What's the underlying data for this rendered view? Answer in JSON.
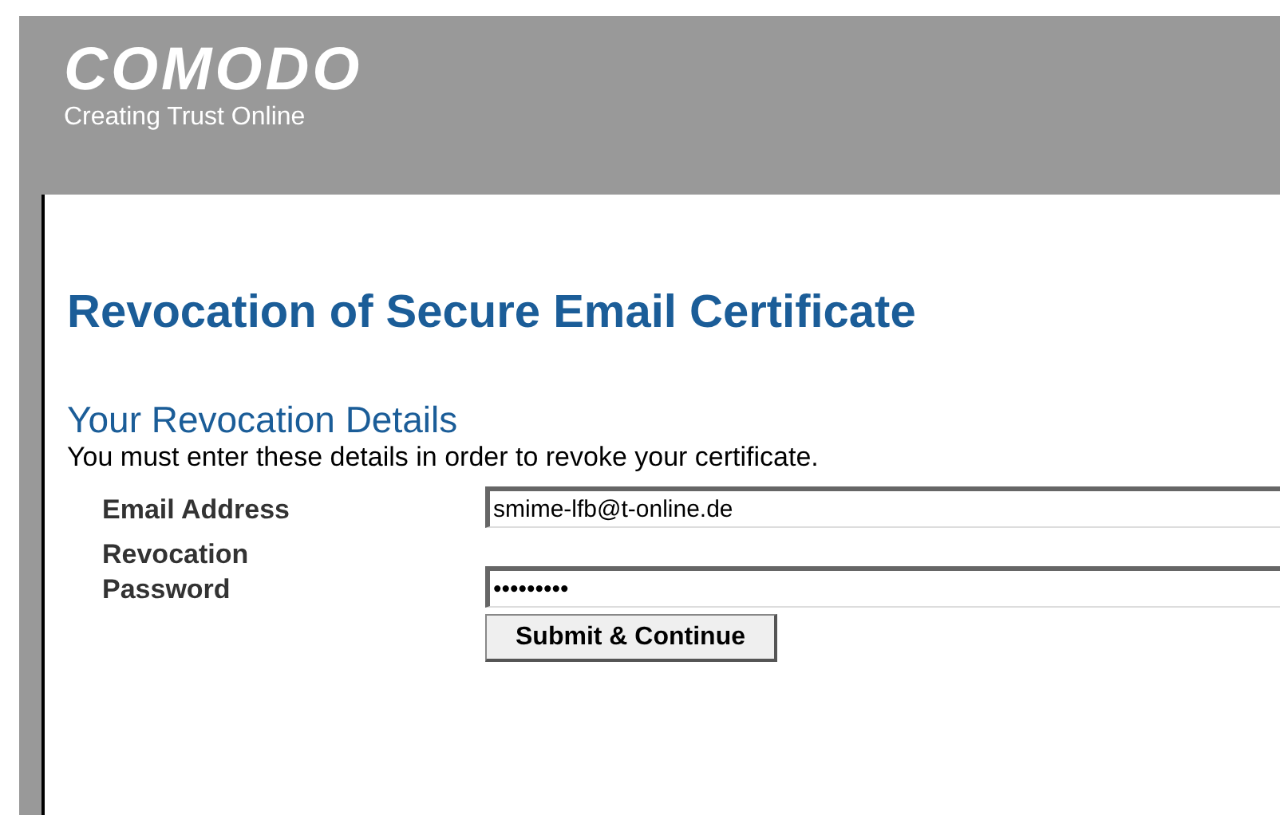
{
  "header": {
    "logo": "COMODO",
    "tagline": "Creating Trust Online"
  },
  "title": "Revocation of Secure Email Certificate",
  "section": {
    "heading": "Your Revocation Details",
    "text": "You must enter these details in order to revoke your certificate."
  },
  "fields": [
    {
      "label": "Email Address",
      "value": "smime-lfb@t-online.de"
    },
    {
      "label": "Revocation Password",
      "value": "•••••••••"
    }
  ],
  "buttons": [
    "Submit & Continue"
  ]
}
